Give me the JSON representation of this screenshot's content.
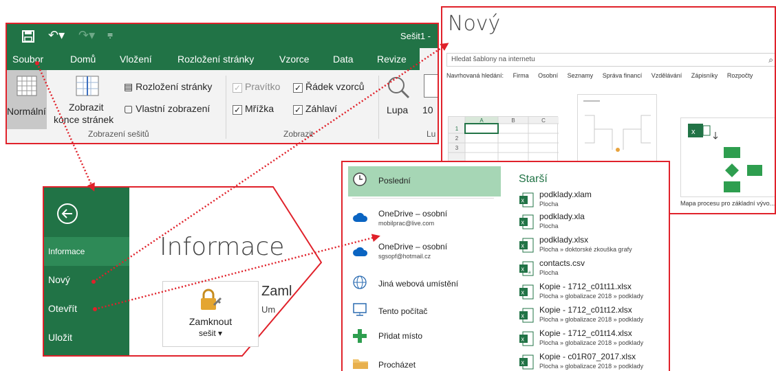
{
  "excel": {
    "window_title": "Sešit1 -",
    "tabs": [
      "Soubor",
      "Domů",
      "Vložení",
      "Rozložení stránky",
      "Vzorce",
      "Data",
      "Revize"
    ],
    "ribbon": {
      "normal_label": "Normální",
      "page_break_label_line1": "Zobrazit",
      "page_break_label_line2": "konce stránek",
      "page_layout_label": "Rozložení stránky",
      "custom_views_label": "Vlastní zobrazení",
      "ruler_label": "Pravítko",
      "formula_bar_label": "Řádek vzorců",
      "gridlines_label": "Mřížka",
      "headings_label": "Záhlaví",
      "zoom_label": "Lupa",
      "zoom_100_label": "10",
      "group_workbook_views": "Zobrazení sešitů",
      "group_show": "Zobrazit",
      "group_zoom": "Lu"
    }
  },
  "new_panel": {
    "title": "Nový",
    "search_placeholder": "Hledat šablony na internetu",
    "suggested": [
      "Navrhovaná hledání:",
      "Firma",
      "Osobní",
      "Seznamy",
      "Správa financí",
      "Vzdělávání",
      "Zápisníky",
      "Rozpočty"
    ],
    "sheet_cols": [
      "A",
      "B",
      "C"
    ],
    "sheet_rows": [
      "1",
      "2",
      "3"
    ],
    "process_map_label": "Mapa procesu pro základní vývo..."
  },
  "backstage": {
    "items": [
      "Informace",
      "Nový",
      "Otevřít",
      "Uložit"
    ],
    "title": "Informace",
    "lock_line1": "Zamknout",
    "lock_line2": "sešit ▾",
    "zamk": "Zaml",
    "um": "Um"
  },
  "open_panel": {
    "locations": [
      {
        "label": "Poslední",
        "sub": ""
      },
      {
        "label": "OneDrive – osobní",
        "sub": "mobilprac@live.com"
      },
      {
        "label": "OneDrive – osobní",
        "sub": "sgsopf@hotmail.cz"
      },
      {
        "label": "Jiná webová umístění",
        "sub": ""
      },
      {
        "label": "Tento počítač",
        "sub": ""
      },
      {
        "label": "Přidat místo",
        "sub": ""
      },
      {
        "label": "Procházet",
        "sub": ""
      }
    ],
    "older_heading": "Starší",
    "files": [
      {
        "name": "podklady.xlam",
        "path": "Plocha"
      },
      {
        "name": "podklady.xla",
        "path": "Plocha"
      },
      {
        "name": "podklady.xlsx",
        "path": "Plocha » doktorské zkouška grafy"
      },
      {
        "name": "contacts.csv",
        "path": "Plocha"
      },
      {
        "name": "Kopie - 1712_c01t11.xlsx",
        "path": "Plocha » globalizace 2018 » podklady"
      },
      {
        "name": "Kopie - 1712_c01t12.xlsx",
        "path": "Plocha » globalizace 2018 » podklady"
      },
      {
        "name": "Kopie - 1712_c01t14.xlsx",
        "path": "Plocha » globalizace 2018 » podklady"
      },
      {
        "name": "Kopie - c01R07_2017.xlsx",
        "path": "Plocha » globalizace 2018 » podklady"
      }
    ]
  },
  "colors": {
    "excel_green": "#217346",
    "annotation_red": "#e0212a",
    "selected_green": "#a6d6b5"
  }
}
